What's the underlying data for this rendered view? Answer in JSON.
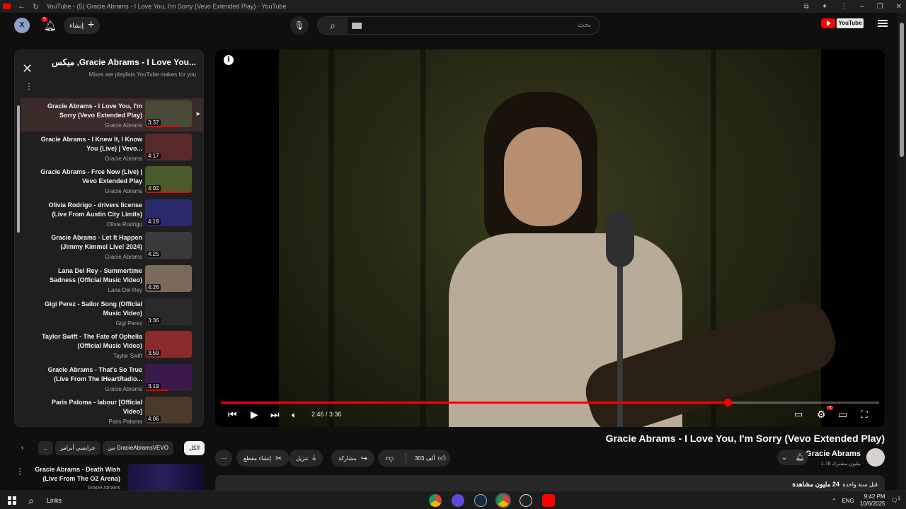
{
  "window": {
    "title": "YouTube - (5) Gracie Abrams - I Love You, I'm Sorry (Vevo Extended Play) - YouTube"
  },
  "masthead": {
    "search_placeholder": "بحث",
    "create_label": "إنشاء",
    "notification_count": "5",
    "avatar_letter": "X"
  },
  "playlist": {
    "title": "ميكس ,Gracie Abrams - I Love You...",
    "subtitle": "Mixes are playlists YouTube makes for you",
    "items": [
      {
        "title": "Gracie Abrams - I Love You, I'm Sorry (Vevo Extended Play)",
        "channel": "Gracie Abrams",
        "duration": "3:37",
        "active": true,
        "progress": 0.78,
        "thumb": "#4a4a38"
      },
      {
        "title": "Gracie Abrams - I Knew It, I Know You (Live) | Vevo...",
        "channel": "Gracie Abrams",
        "duration": "4:17",
        "active": false,
        "progress": 0.0,
        "thumb": "#5a2a2a"
      },
      {
        "title": "Gracie Abrams - Free Now (Live) | Vevo Extended Play",
        "channel": "Gracie Abrams",
        "duration": "4:02",
        "active": false,
        "progress": 1.0,
        "thumb": "#4a5a2a"
      },
      {
        "title": "Olivia Rodrigo - drivers license (Live From Austin City Limits)",
        "channel": "Olivia Rodrigo",
        "duration": "4:19",
        "active": false,
        "progress": 0.0,
        "thumb": "#2a2a6a"
      },
      {
        "title": "Gracie Abrams - Let It Happen (Jimmy Kimmel Live! 2024)",
        "channel": "Gracie Abrams",
        "duration": "4:25",
        "active": false,
        "progress": 0.0,
        "thumb": "#3a3a3a"
      },
      {
        "title": "Lana Del Rey - Summertime Sadness (Official Music Video)",
        "channel": "Lana Del Rey",
        "duration": "4:26",
        "active": false,
        "progress": 0.0,
        "thumb": "#7a6a5a"
      },
      {
        "title": "Gigi Perez - Sailor Song (Official Music Video)",
        "channel": "Gigi Perez",
        "duration": "3:36",
        "active": false,
        "progress": 0.0,
        "thumb": "#2a2a2a"
      },
      {
        "title": "Taylor Swift - The Fate of Ophelia (Official Music Video)",
        "channel": "Taylor Swift",
        "duration": "3:59",
        "active": false,
        "progress": 0.0,
        "thumb": "#8a2a2a"
      },
      {
        "title": "Gracie Abrams - That's So True (Live From The iHeartRadio...",
        "channel": "Gracie Abrams",
        "duration": "3:19",
        "active": false,
        "progress": 0.5,
        "thumb": "#3a1a4a"
      },
      {
        "title": "Paris Paloma - labour [Official Video]",
        "channel": "Paris Paloma",
        "duration": "4:06",
        "active": false,
        "progress": 0.0,
        "thumb": "#4a3a2a"
      }
    ]
  },
  "chips": [
    "الكل",
    "من GracieAbramsVEVO",
    "جرايسي أبرامز",
    "..."
  ],
  "recommendation": {
    "title": "Gracie Abrams - Death Wish (Live From The O2 Arena)",
    "channel": "Gracie Abrams"
  },
  "player": {
    "current_time": "2:46",
    "duration": "3:36",
    "time_display": "2:46 / 3:36",
    "progress": 0.77,
    "hd_badge": "HD"
  },
  "video": {
    "title": "Gracie Abrams - I Love You, I'm Sorry (Vevo Extended Play)",
    "channel": "Gracie Abrams",
    "subscribers": "1.78 مليون مشترك",
    "likes": "303 ألف",
    "share_label": "مشاركة",
    "download_label": "تنزيل",
    "clip_label": "إنشاء مقطع",
    "views": "24 مليون مشاهدة",
    "date": "قبل سنة واحدة"
  },
  "taskbar": {
    "links_label": "Links",
    "language": "ENG",
    "time": "9:42 PM",
    "date": "10/6/2025",
    "notification_count": "3"
  }
}
